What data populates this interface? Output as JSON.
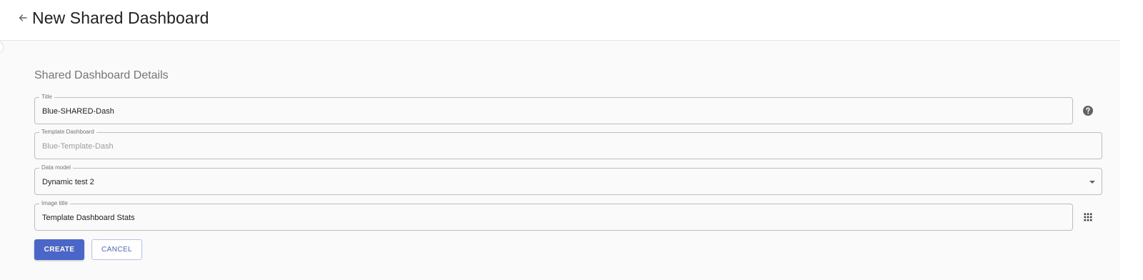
{
  "header": {
    "back_icon": "arrow-left-icon",
    "title": "New Shared Dashboard"
  },
  "form": {
    "section_heading": "Shared Dashboard Details",
    "title_field": {
      "label": "Title",
      "value": "Blue-SHARED-Dash",
      "help_icon": "help-circle-icon"
    },
    "template_field": {
      "label": "Template Dashboard",
      "value": "Blue-Template-Dash"
    },
    "data_model_field": {
      "label": "Data model",
      "value": "Dynamic test 2",
      "dropdown_icon": "caret-down-icon"
    },
    "image_title_field": {
      "label": "Image title",
      "value": "Template Dashboard Stats",
      "picker_icon": "grid-apps-icon"
    }
  },
  "actions": {
    "create_label": "CREATE",
    "cancel_label": "CANCEL"
  },
  "colors": {
    "primary": "#4a66c9",
    "border": "#bdbdbd",
    "background": "#fafafa"
  }
}
